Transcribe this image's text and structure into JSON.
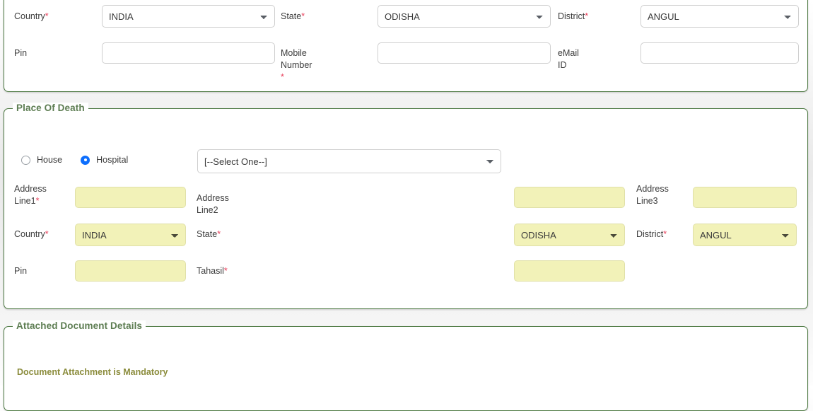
{
  "contact_section": {
    "fields": {
      "country_label": "Country",
      "country_value": "INDIA",
      "state_label": "State",
      "state_value": "ODISHA",
      "district_label": "District",
      "district_value": "ANGUL",
      "pin_label": "Pin",
      "pin_value": "",
      "mobile_label": "Mobile Number ",
      "mobile_value": "",
      "email_label": "eMail ID",
      "email_value": ""
    },
    "required_marker": "*"
  },
  "place_of_death": {
    "legend": "Place Of Death",
    "options": [
      {
        "label": "House",
        "checked": false
      },
      {
        "label": "Hospital",
        "checked": true
      }
    ],
    "hospital_select_value": "[--Select One--]",
    "fields": {
      "address1_label": "Address\nLine1",
      "address1_value": "",
      "address2_label": "Address Line2",
      "address2_value": "",
      "address3_label": "Address\nLine3",
      "address3_value": "",
      "country_label": "Country",
      "country_value": "INDIA",
      "state_label": "State",
      "state_value": "ODISHA",
      "district_label": "District",
      "district_value": "ANGUL",
      "pin_label": "Pin",
      "pin_value": "",
      "tahasil_label": "Tahasil",
      "tahasil_value": ""
    },
    "required_marker": "*"
  },
  "attached_documents": {
    "legend": "Attached Document Details",
    "note": "Document Attachment is Mandatory"
  },
  "colors": {
    "panel_border": "#4e7a43",
    "legend_text": "#5d7d52",
    "required": "#e8415c",
    "input_yellow": "#f2f2b8",
    "radio_selected": "#0d6efd",
    "doc_note": "#8b8c3c"
  }
}
